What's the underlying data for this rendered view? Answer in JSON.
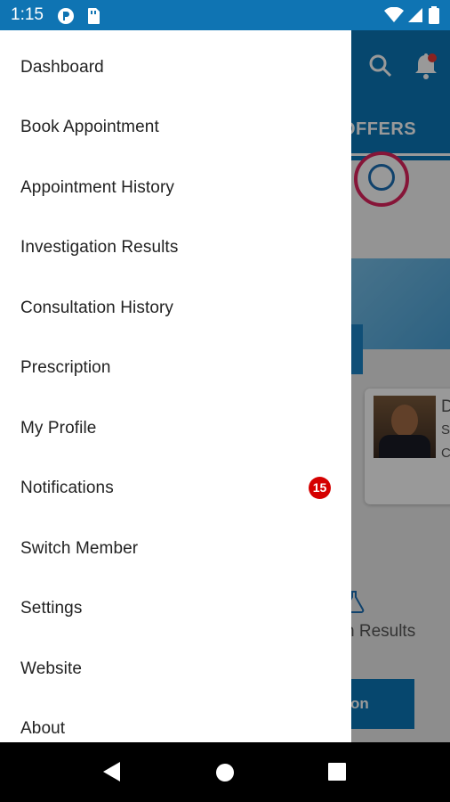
{
  "status_bar": {
    "time": "1:15"
  },
  "background_app": {
    "tab_label": "OFFERS",
    "results_fragment": "n Results",
    "action_fragment": "on",
    "card_fragments": [
      "D",
      "S",
      "C"
    ]
  },
  "drawer": {
    "items": [
      {
        "label": "Dashboard"
      },
      {
        "label": "Book Appointment"
      },
      {
        "label": "Appointment History"
      },
      {
        "label": "Investigation Results"
      },
      {
        "label": "Consultation History"
      },
      {
        "label": "Prescription"
      },
      {
        "label": "My Profile"
      },
      {
        "label": "Notifications",
        "badge": "15"
      },
      {
        "label": "Switch Member"
      },
      {
        "label": "Settings"
      },
      {
        "label": "Website"
      },
      {
        "label": "About"
      }
    ]
  },
  "colors": {
    "status_bar": "#0f74b3",
    "toolbar": "#0b77b7",
    "badge": "#d50000"
  }
}
